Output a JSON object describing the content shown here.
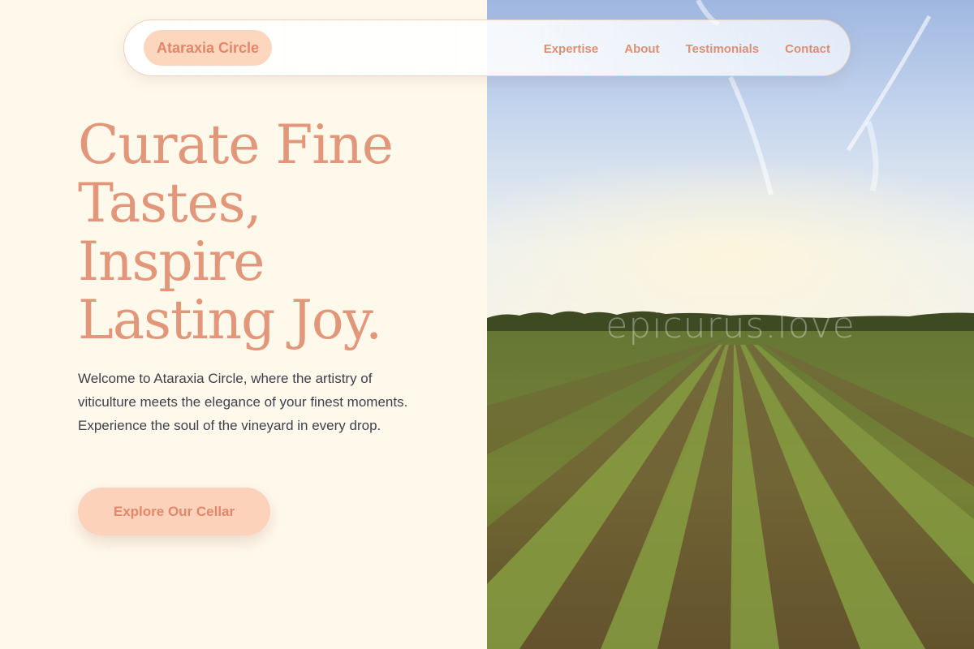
{
  "nav": {
    "brand": "Ataraxia Circle",
    "links": [
      "Expertise",
      "About",
      "Testimonials",
      "Contact"
    ]
  },
  "hero": {
    "headline": [
      "Curate Fine",
      "Tastes,",
      "Inspire",
      "Lasting Joy."
    ],
    "intro": "Welcome to Ataraxia Circle, where the artistry of viticulture meets the elegance of your finest moments. Experience the soul of the vineyard in every drop.",
    "cta_label": "Explore Our Cellar",
    "image_watermark": "epicurus.love",
    "image_subject": "vineyard-rows-at-sunset"
  },
  "colors": {
    "background": "#fff9ec",
    "accent": "#e3977a",
    "accent_soft": "#fcd6bd",
    "body_text": "#3f3f4e"
  }
}
